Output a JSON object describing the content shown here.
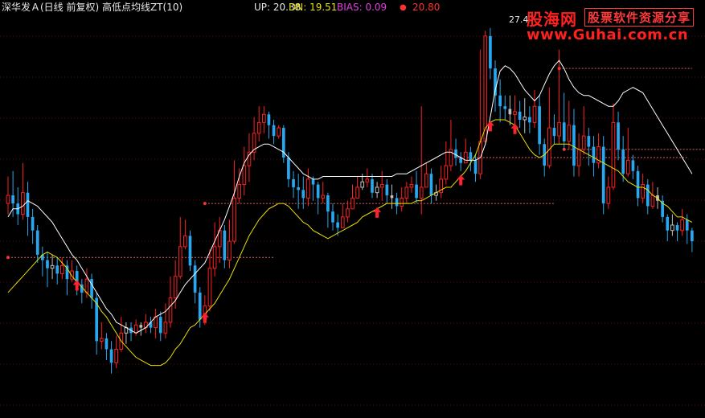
{
  "header": {
    "title": "深华发Ａ(日线 前复权) 高低点均线ZT(10)",
    "up": "UP: 20.38",
    "dn": "DN: 19.51",
    "bias": "BIAS: 0.09",
    "dot": "●",
    "last": "20.80"
  },
  "high_label": "27.4",
  "watermark": {
    "site_cn": "股海网",
    "slogan": "股票软件资源分享",
    "url": "www.Guhai.com.cn"
  },
  "colors": {
    "background": "#000000",
    "up_candle": "#ff2020",
    "down_candle": "#28a8f0",
    "neutral_candle": "#c0c0c0",
    "upper_line": "#ffffff",
    "lower_line": "#e8e000",
    "level_line": "#e06060",
    "arrow": "#ff2030"
  },
  "chart_data": {
    "type": "candlestick",
    "title": "深华发Ａ(日线 前复权) 高低点均线ZT(10)",
    "indicators": {
      "UP": 20.38,
      "DN": 19.51,
      "BIAS": 0.09,
      "last": 20.8
    },
    "ylim": [
      14.5,
      29.0
    ],
    "annotated_high": 27.4,
    "candles": [
      [
        22.0,
        22.3,
        23.0,
        21.6
      ],
      [
        22.3,
        22.0,
        23.2,
        21.5
      ],
      [
        22.0,
        21.6,
        22.6,
        21.2
      ],
      [
        21.6,
        22.4,
        23.5,
        21.4
      ],
      [
        22.4,
        21.5,
        22.8,
        20.8
      ],
      [
        21.5,
        21.0,
        21.8,
        20.5
      ],
      [
        21.0,
        20.1,
        21.2,
        19.8
      ],
      [
        20.1,
        19.9,
        20.4,
        19.3
      ],
      [
        19.9,
        19.6,
        20.2,
        18.9
      ],
      [
        19.6,
        19.7,
        20.1,
        19.2
      ],
      [
        19.7,
        19.4,
        20.0,
        19.0
      ],
      [
        19.4,
        19.7,
        20.0,
        19.2
      ],
      [
        19.7,
        19.2,
        19.9,
        18.6
      ],
      [
        19.2,
        19.5,
        19.9,
        19.1
      ],
      [
        19.5,
        19.0,
        19.7,
        18.6
      ],
      [
        19.0,
        18.7,
        19.2,
        18.3
      ],
      [
        18.7,
        19.2,
        19.6,
        18.5
      ],
      [
        19.2,
        18.5,
        19.4,
        18.1
      ],
      [
        18.5,
        16.9,
        18.7,
        16.4
      ],
      [
        16.9,
        17.0,
        17.6,
        16.6
      ],
      [
        17.0,
        16.6,
        17.2,
        16.2
      ],
      [
        16.6,
        16.1,
        16.9,
        15.7
      ],
      [
        16.1,
        16.6,
        17.1,
        15.9
      ],
      [
        16.6,
        17.2,
        17.8,
        16.5
      ],
      [
        17.2,
        17.4,
        17.6,
        16.8
      ],
      [
        17.4,
        17.2,
        17.6,
        16.9
      ],
      [
        17.2,
        17.5,
        17.7,
        17.1
      ],
      [
        17.5,
        17.4,
        17.6,
        17.1
      ],
      [
        17.4,
        17.6,
        17.9,
        17.2
      ],
      [
        17.6,
        17.4,
        17.8,
        17.2
      ],
      [
        17.4,
        17.8,
        18.1,
        17.0
      ],
      [
        17.8,
        17.2,
        18.0,
        16.9
      ],
      [
        17.2,
        17.6,
        18.3,
        17.0
      ],
      [
        17.6,
        18.5,
        19.3,
        17.4
      ],
      [
        18.5,
        19.3,
        19.9,
        18.1
      ],
      [
        19.3,
        20.4,
        21.5,
        19.2
      ],
      [
        20.4,
        20.8,
        21.4,
        20.3
      ],
      [
        20.8,
        19.7,
        21.0,
        19.5
      ],
      [
        19.7,
        18.7,
        19.9,
        18.3
      ],
      [
        18.7,
        17.7,
        18.9,
        17.4
      ],
      [
        17.7,
        18.2,
        18.6,
        17.5
      ],
      [
        18.2,
        19.6,
        20.3,
        18.0
      ],
      [
        19.6,
        20.4,
        21.3,
        19.3
      ],
      [
        20.4,
        21.0,
        21.5,
        19.8
      ],
      [
        21.0,
        19.9,
        21.2,
        19.6
      ],
      [
        19.9,
        20.6,
        21.4,
        19.6
      ],
      [
        20.6,
        22.2,
        23.6,
        20.5
      ],
      [
        22.2,
        22.7,
        23.3,
        22.0
      ],
      [
        22.7,
        23.4,
        24.1,
        22.3
      ],
      [
        23.4,
        23.9,
        24.6,
        22.8
      ],
      [
        23.9,
        24.6,
        25.2,
        23.6
      ],
      [
        24.6,
        25.0,
        25.6,
        24.3
      ],
      [
        25.0,
        25.3,
        25.6,
        24.6
      ],
      [
        25.3,
        24.9,
        25.4,
        24.4
      ],
      [
        24.9,
        24.5,
        25.1,
        24.2
      ],
      [
        24.5,
        24.8,
        24.9,
        24.4
      ],
      [
        24.8,
        23.7,
        24.9,
        23.5
      ],
      [
        23.7,
        22.9,
        23.9,
        22.6
      ],
      [
        22.9,
        22.6,
        23.2,
        22.2
      ],
      [
        22.6,
        22.5,
        23.1,
        21.8
      ],
      [
        22.5,
        22.2,
        23.0,
        21.8
      ],
      [
        22.2,
        22.9,
        23.3,
        21.9
      ],
      [
        22.9,
        22.7,
        23.0,
        22.1
      ],
      [
        22.7,
        22.2,
        22.8,
        21.6
      ],
      [
        22.2,
        22.3,
        22.8,
        22.0
      ],
      [
        22.3,
        21.7,
        22.4,
        21.1
      ],
      [
        21.7,
        21.3,
        22.0,
        21.0
      ],
      [
        21.3,
        21.1,
        21.6,
        20.8
      ],
      [
        21.1,
        21.5,
        22.0,
        21.2
      ],
      [
        21.5,
        21.8,
        22.1,
        21.3
      ],
      [
        21.8,
        22.2,
        22.7,
        21.8
      ],
      [
        22.2,
        22.6,
        23.0,
        22.4
      ],
      [
        22.6,
        22.8,
        23.1,
        22.5
      ],
      [
        22.8,
        22.9,
        23.3,
        22.6
      ],
      [
        22.9,
        22.4,
        23.1,
        22.2
      ],
      [
        22.4,
        22.6,
        22.8,
        22.2
      ],
      [
        22.6,
        22.7,
        23.2,
        22.1
      ],
      [
        22.7,
        22.3,
        22.9,
        22.0
      ],
      [
        22.3,
        22.2,
        22.7,
        21.8
      ],
      [
        22.2,
        21.9,
        22.4,
        21.6
      ],
      [
        21.9,
        22.2,
        22.6,
        21.7
      ],
      [
        22.2,
        22.6,
        22.8,
        22.0
      ],
      [
        22.6,
        22.7,
        23.0,
        22.4
      ],
      [
        22.7,
        22.2,
        23.2,
        22.0
      ],
      [
        22.2,
        22.6,
        25.6,
        21.6
      ],
      [
        22.6,
        23.1,
        23.5,
        22.6
      ],
      [
        23.1,
        22.3,
        23.3,
        22.0
      ],
      [
        22.3,
        22.4,
        22.7,
        22.1
      ],
      [
        22.4,
        22.9,
        23.4,
        22.2
      ],
      [
        22.9,
        23.4,
        24.3,
        22.7
      ],
      [
        23.4,
        24.0,
        25.1,
        23.2
      ],
      [
        24.0,
        23.7,
        24.4,
        23.4
      ],
      [
        23.7,
        23.5,
        23.9,
        23.2
      ],
      [
        23.5,
        23.9,
        24.4,
        23.6
      ],
      [
        23.9,
        23.6,
        24.1,
        23.2
      ],
      [
        23.6,
        23.1,
        23.8,
        22.8
      ],
      [
        23.1,
        24.3,
        27.7,
        22.9
      ],
      [
        24.3,
        28.2,
        28.4,
        24.2
      ],
      [
        28.2,
        27.0,
        28.5,
        26.6
      ],
      [
        27.0,
        26.0,
        27.3,
        25.4
      ],
      [
        26.0,
        25.6,
        26.6,
        25.0
      ],
      [
        25.6,
        25.5,
        26.0,
        25.1
      ],
      [
        25.5,
        25.3,
        26.0,
        24.9
      ],
      [
        25.3,
        25.4,
        26.0,
        24.6
      ],
      [
        25.4,
        25.1,
        25.8,
        24.8
      ],
      [
        25.1,
        25.2,
        25.9,
        24.6
      ],
      [
        25.2,
        25.0,
        25.6,
        24.6
      ],
      [
        25.0,
        25.6,
        26.2,
        24.8
      ],
      [
        25.6,
        24.2,
        26.0,
        23.8
      ],
      [
        24.2,
        23.4,
        24.4,
        23.0
      ],
      [
        23.4,
        24.8,
        26.3,
        23.3
      ],
      [
        24.8,
        24.5,
        25.3,
        24.2
      ],
      [
        24.5,
        25.0,
        27.7,
        24.2
      ],
      [
        25.0,
        24.3,
        26.1,
        24.0
      ],
      [
        24.3,
        24.9,
        25.8,
        24.0
      ],
      [
        24.9,
        23.4,
        25.5,
        23.0
      ],
      [
        23.4,
        24.0,
        24.6,
        23.0
      ],
      [
        24.0,
        24.5,
        25.6,
        23.8
      ],
      [
        24.5,
        24.1,
        24.8,
        23.4
      ],
      [
        24.1,
        23.5,
        24.5,
        23.0
      ],
      [
        23.5,
        24.1,
        24.6,
        23.3
      ],
      [
        24.1,
        22.0,
        24.5,
        21.6
      ],
      [
        22.0,
        22.6,
        23.0,
        21.8
      ],
      [
        22.6,
        25.0,
        25.7,
        22.5
      ],
      [
        25.0,
        24.0,
        25.4,
        23.6
      ],
      [
        24.0,
        23.1,
        24.5,
        22.8
      ],
      [
        23.1,
        23.6,
        24.8,
        23.0
      ],
      [
        23.6,
        23.2,
        23.8,
        22.9
      ],
      [
        23.2,
        22.2,
        23.4,
        21.9
      ],
      [
        22.2,
        22.7,
        23.1,
        22.0
      ],
      [
        22.7,
        21.9,
        22.9,
        21.6
      ],
      [
        21.9,
        22.3,
        22.8,
        21.8
      ],
      [
        22.3,
        22.1,
        22.6,
        21.8
      ],
      [
        22.1,
        21.5,
        22.3,
        21.3
      ],
      [
        21.5,
        21.0,
        21.6,
        20.6
      ],
      [
        21.0,
        21.2,
        21.6,
        20.8
      ],
      [
        21.2,
        21.0,
        21.3,
        20.6
      ],
      [
        21.0,
        21.4,
        21.8,
        20.8
      ],
      [
        21.4,
        21.0,
        21.6,
        20.5
      ],
      [
        21.0,
        20.6,
        21.1,
        20.2
      ]
    ],
    "upper_line": [
      21.5,
      21.8,
      21.8,
      21.9,
      22.1,
      22.0,
      21.9,
      21.7,
      21.5,
      21.3,
      21.0,
      20.7,
      20.4,
      20.1,
      19.9,
      19.6,
      19.3,
      19.0,
      18.7,
      18.4,
      18.1,
      17.9,
      17.6,
      17.5,
      17.4,
      17.3,
      17.2,
      17.3,
      17.4,
      17.6,
      17.8,
      17.9,
      18.0,
      18.2,
      18.4,
      18.7,
      19.0,
      19.2,
      19.4,
      19.6,
      19.8,
      20.2,
      20.6,
      21.0,
      21.4,
      21.9,
      22.4,
      23.0,
      23.5,
      23.8,
      24.0,
      24.1,
      24.2,
      24.2,
      24.1,
      24.0,
      23.9,
      23.7,
      23.5,
      23.3,
      23.1,
      23.0,
      22.9,
      22.9,
      23.0,
      23.0,
      23.0,
      23.0,
      23.0,
      23.0,
      23.0,
      23.0,
      23.0,
      23.0,
      23.0,
      23.0,
      23.0,
      23.0,
      23.0,
      23.1,
      23.1,
      23.1,
      23.2,
      23.3,
      23.4,
      23.5,
      23.6,
      23.7,
      23.8,
      23.9,
      23.9,
      23.8,
      23.7,
      23.6,
      23.6,
      23.6,
      23.7,
      24.2,
      25.2,
      26.2,
      26.9,
      27.1,
      27.0,
      26.8,
      26.5,
      26.2,
      26.0,
      25.8,
      26.0,
      26.4,
      26.8,
      27.1,
      27.3,
      27.0,
      26.6,
      26.3,
      26.1,
      26.0,
      26.0,
      25.9,
      25.8,
      25.7,
      25.6,
      25.6,
      25.8,
      26.1,
      26.2,
      26.3,
      26.2,
      26.1,
      25.8,
      25.5,
      25.2,
      24.9,
      24.6,
      24.3,
      24.0,
      23.7,
      23.4,
      23.1
    ],
    "lower_line": [
      18.7,
      18.9,
      19.1,
      19.3,
      19.5,
      19.7,
      19.9,
      20.1,
      20.2,
      20.1,
      20.0,
      19.8,
      19.6,
      19.3,
      19.1,
      18.9,
      18.7,
      18.5,
      18.3,
      18.0,
      17.8,
      17.5,
      17.2,
      16.9,
      16.7,
      16.5,
      16.3,
      16.2,
      16.1,
      16.0,
      16.0,
      16.0,
      16.1,
      16.3,
      16.6,
      16.8,
      17.1,
      17.4,
      17.5,
      17.7,
      17.9,
      18.1,
      18.3,
      18.6,
      18.9,
      19.2,
      19.6,
      20.0,
      20.4,
      20.8,
      21.1,
      21.4,
      21.6,
      21.8,
      21.9,
      22.0,
      22.0,
      21.9,
      21.7,
      21.5,
      21.3,
      21.2,
      21.0,
      20.9,
      20.8,
      20.7,
      20.8,
      20.9,
      21.0,
      21.1,
      21.2,
      21.3,
      21.5,
      21.6,
      21.7,
      21.8,
      21.9,
      22.0,
      22.0,
      22.0,
      22.0,
      22.0,
      22.0,
      22.1,
      22.1,
      22.2,
      22.3,
      22.4,
      22.5,
      22.6,
      22.6,
      22.8,
      23.0,
      23.2,
      23.5,
      23.8,
      24.3,
      24.8,
      25.0,
      25.1,
      25.1,
      25.1,
      25.0,
      24.9,
      24.6,
      24.3,
      24.0,
      23.8,
      23.7,
      23.8,
      24.0,
      24.2,
      24.2,
      24.2,
      24.2,
      24.1,
      24.0,
      23.9,
      23.8,
      23.7,
      23.6,
      23.5,
      23.4,
      23.3,
      23.2,
      23.0,
      22.8,
      22.7,
      22.6,
      22.6,
      22.5,
      22.3,
      22.2,
      22.0,
      21.9,
      21.7,
      21.5,
      21.5,
      21.4,
      21.3
    ],
    "levels": [
      {
        "price": 20.0,
        "from": 0,
        "to": 54
      },
      {
        "price": 22.0,
        "from": 40,
        "to": 111
      },
      {
        "price": 23.7,
        "from": 90,
        "to": 138
      },
      {
        "price": 24.0,
        "from": 113,
        "to": 147
      },
      {
        "price": 27.0,
        "from": 112,
        "to": 139
      }
    ],
    "buy_arrows": [
      14,
      40,
      75,
      92,
      98,
      103
    ]
  }
}
